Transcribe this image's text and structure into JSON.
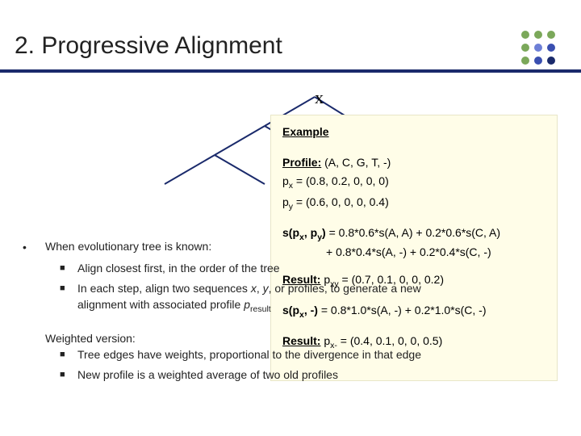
{
  "title": "2. Progressive Alignment",
  "tree_x_label": "x",
  "body": {
    "when_known": "When evolutionary tree is known:",
    "sub1": "Align closest first, in the order of the tree",
    "sub2_a": "In each step, align two sequences ",
    "sub2_b": ", or profiles, to generate a new",
    "sub3_a": "alignment with associated profile ",
    "weighted_hdr": "Weighted version:",
    "w1": "Tree edges have weights, proportional to the divergence in that edge",
    "w2_a": "New profile is a weighted average",
    "w2_b": " of two old profiles"
  },
  "example": {
    "title": "Example",
    "profile_label": "Profile:",
    "profile_val": " (A, C, G, T, -)",
    "px": "p_x = (0.8, 0.2, 0, 0, 0)",
    "py": "p_y = (0.6, 0, 0, 0, 0.4)",
    "score1a": "s(p_x, p_y) = 0.8*0.6*s(A, A) + 0.2*0.6*s(C, A)",
    "score1b": "+ 0.8*0.4*s(A, -) + 0.2*0.4*s(C, -)",
    "result_label": "Result:",
    "result1": " p_xy = (0.7, 0.1, 0, 0, 0.2)",
    "score2": "s(p_x, -) = 0.8*1.0*s(A, -) + 0.2*1.0*s(C, -)",
    "result2": " p_x- = (0.4, 0.1, 0, 0, 0.5)"
  }
}
